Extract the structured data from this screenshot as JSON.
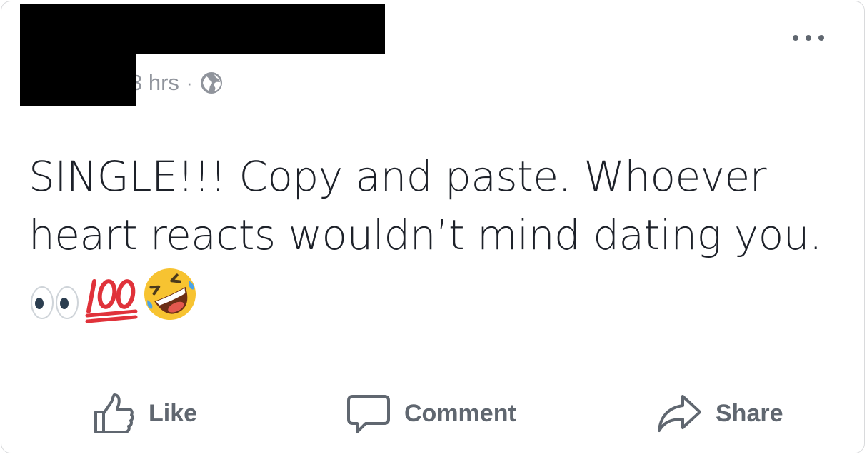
{
  "post": {
    "timestamp": "3 hrs",
    "separator": "·",
    "privacy_icon": "globe-icon",
    "more_icon": "more-options-icon",
    "text": "SINGLE!!! Copy and paste. Whoever heart reacts wouldn’t mind dating you.",
    "emojis": [
      "eyes-emoji",
      "hundred-points-emoji",
      "rolling-on-floor-laughing-emoji"
    ]
  },
  "actions": {
    "like": {
      "label": "Like",
      "icon": "thumbs-up-icon"
    },
    "comment": {
      "label": "Comment",
      "icon": "speech-bubble-icon"
    },
    "share": {
      "label": "Share",
      "icon": "share-arrow-icon"
    }
  },
  "colors": {
    "text": "#1d2129",
    "meta": "#90949c",
    "action": "#606770",
    "divider": "#dadde1",
    "redaction": "#000000"
  }
}
